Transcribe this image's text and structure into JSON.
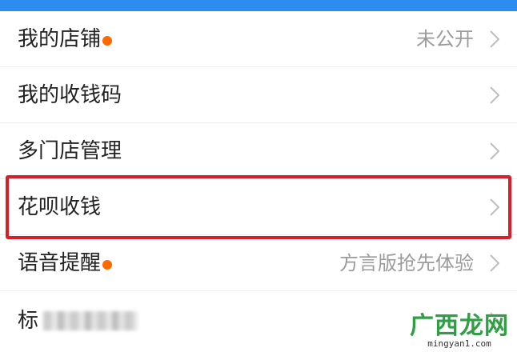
{
  "colors": {
    "accent_bar": "#2d8cf0",
    "highlight_border": "#d81e28",
    "notification_dot": "#ff6a00",
    "watermark": "#2f9e44"
  },
  "menu": {
    "items": [
      {
        "label": "我的店铺",
        "has_dot": true,
        "value": "未公开",
        "icon": "chevron-right-icon"
      },
      {
        "label": "我的收钱码",
        "has_dot": false,
        "value": "",
        "icon": "chevron-right-icon"
      },
      {
        "label": "多门店管理",
        "has_dot": false,
        "value": "",
        "icon": "chevron-right-icon"
      },
      {
        "label": "花呗收钱",
        "has_dot": false,
        "value": "",
        "icon": "chevron-right-icon",
        "highlighted": true
      },
      {
        "label": "语音提醒",
        "has_dot": true,
        "value": "方言版抢先体验",
        "icon": "chevron-right-icon"
      },
      {
        "label": "标",
        "has_dot": false,
        "value": "",
        "icon": "chevron-right-icon",
        "obscured": true
      }
    ]
  },
  "watermark": {
    "main": "广西龙网",
    "sub": "mingyan1.com"
  }
}
